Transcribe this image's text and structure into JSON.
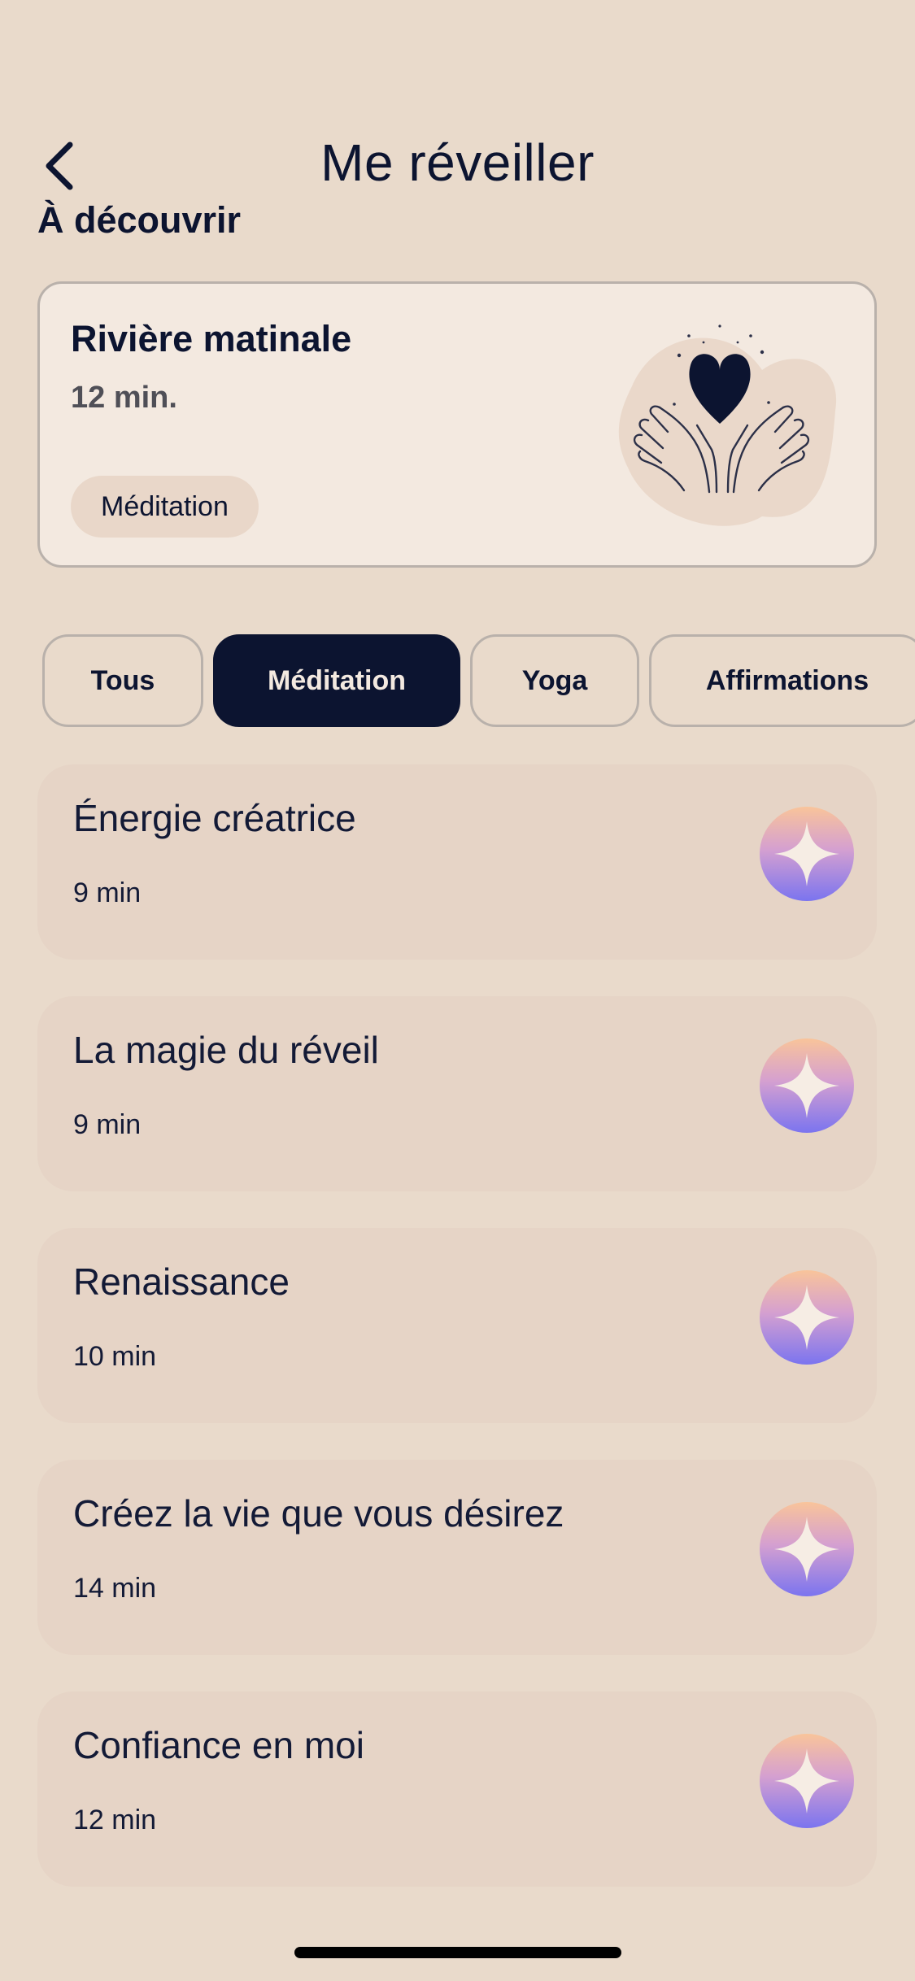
{
  "header": {
    "title": "Me réveiller",
    "back_icon": "chevron-left-icon"
  },
  "discover": {
    "section_title": "À découvrir",
    "card": {
      "title": "Rivière matinale",
      "duration": "12 min.",
      "tag": "Méditation",
      "illustration": "hands-holding-heart-icon"
    }
  },
  "tabs": [
    {
      "label": "Tous",
      "active": false
    },
    {
      "label": "Méditation",
      "active": true
    },
    {
      "label": "Yoga",
      "active": false
    },
    {
      "label": "Affirmations",
      "active": false
    }
  ],
  "sessions": [
    {
      "title": "Énergie créatrice",
      "duration": "9 min",
      "icon": "sparkle-icon"
    },
    {
      "title": "La magie du réveil",
      "duration": "9 min",
      "icon": "sparkle-icon"
    },
    {
      "title": "Renaissance",
      "duration": "10 min",
      "icon": "sparkle-icon"
    },
    {
      "title": "Créez la vie que vous désirez",
      "duration": "14 min",
      "icon": "sparkle-icon"
    },
    {
      "title": "Confiance en moi",
      "duration": "12 min",
      "icon": "sparkle-icon"
    }
  ],
  "colors": {
    "background": "#e9dacb",
    "ink": "#0c1430",
    "card": "#f3e9e0",
    "session_card": "#e6d4c6",
    "active_tab": "#0c1430"
  }
}
